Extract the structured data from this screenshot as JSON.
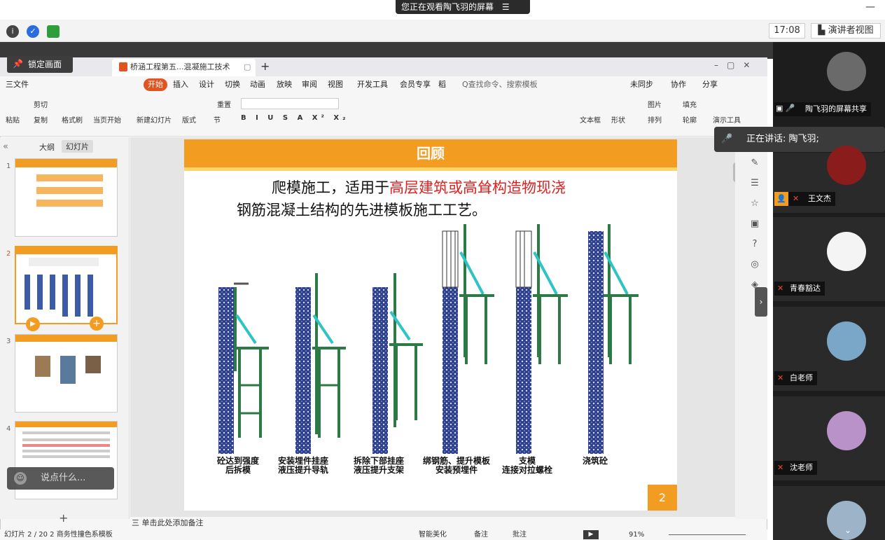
{
  "share": {
    "title": "您正在观看陶飞羽的屏幕",
    "icon": "menu-icon"
  },
  "top": {
    "clock": "17:08",
    "presenter_view": "演讲者视图"
  },
  "lock": {
    "label": "锁定画面"
  },
  "wps": {
    "doc_tab": "桥涵工程第五...混凝施工技术",
    "menus": [
      "三文件",
      "开始",
      "插入",
      "设计",
      "切换",
      "动画",
      "放映",
      "审阅",
      "视图",
      "开发工具",
      "会员专享",
      "稻"
    ],
    "search": "Q查找命令、搜索模板",
    "sync": "未同步",
    "collab": "协作",
    "share": "分享",
    "ribbon": [
      "粘贴",
      "剪切",
      "复制",
      "格式刷",
      "当页开始",
      "新建幻灯片",
      "版式",
      "节",
      "重置",
      "文本框",
      "形状",
      "图片",
      "填充",
      "排列",
      "轮廓",
      "演示工具"
    ],
    "panel_tabs": [
      "大纲",
      "幻灯片"
    ],
    "notes": "三 单击此处添加备注",
    "status": "幻灯片 2 / 20   2 商务性撞色系模板",
    "status_right": [
      "智能美化",
      "备注",
      "批注"
    ],
    "zoom": "91%"
  },
  "slide": {
    "title": "回顾",
    "line1_a": "爬模施工，适用于",
    "line1_b": "高层建筑或高耸构造物现浇",
    "line2": "钢筋混凝土结构的先进模板施工工艺。",
    "number": "2",
    "captions": [
      [
        "砼达到强度",
        "后拆模"
      ],
      [
        "安装埋件挂座",
        "液压提升导轨"
      ],
      [
        "拆除下部挂座",
        "液压提升支架"
      ],
      [
        "绑钢筋、提升模板",
        "安装预埋件"
      ],
      [
        "支模",
        "连接对拉螺栓"
      ],
      [
        "浇筑砼",
        ""
      ]
    ]
  },
  "thumbnails": [
    "1",
    "2",
    "3",
    "4"
  ],
  "chat": {
    "placeholder": "说点什么..."
  },
  "speaking": {
    "label": "正在讲话: 陶飞羽;"
  },
  "participants": [
    {
      "name": "陶飞羽的屏幕共享",
      "icon": "screen-share-icon"
    },
    {
      "name": "王文杰"
    },
    {
      "name": "青春豁达"
    },
    {
      "name": "白老师"
    },
    {
      "name": "沈老师"
    }
  ]
}
